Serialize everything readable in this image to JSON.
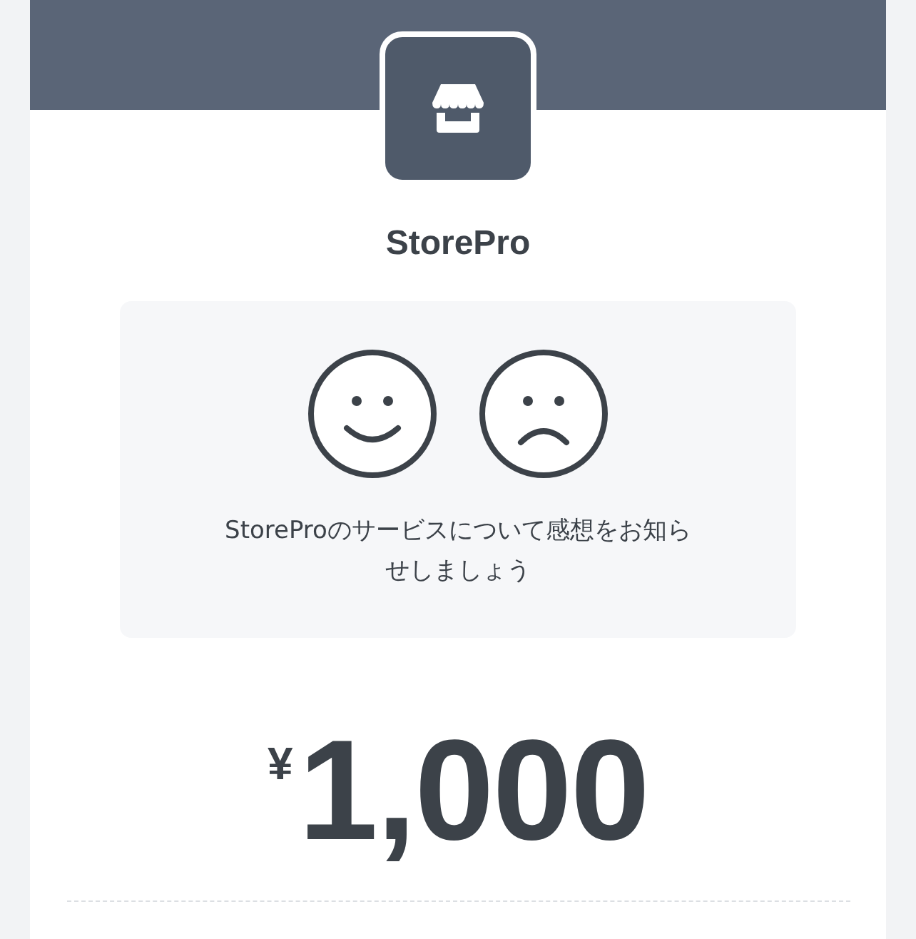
{
  "app_name": "StorePro",
  "feedback": {
    "options": [
      {
        "kind": "happy"
      },
      {
        "kind": "sad"
      }
    ],
    "message": "StoreProのサービスについて感想をお知らせしましょう"
  },
  "price": {
    "currency": "¥",
    "amount": "1,000"
  }
}
